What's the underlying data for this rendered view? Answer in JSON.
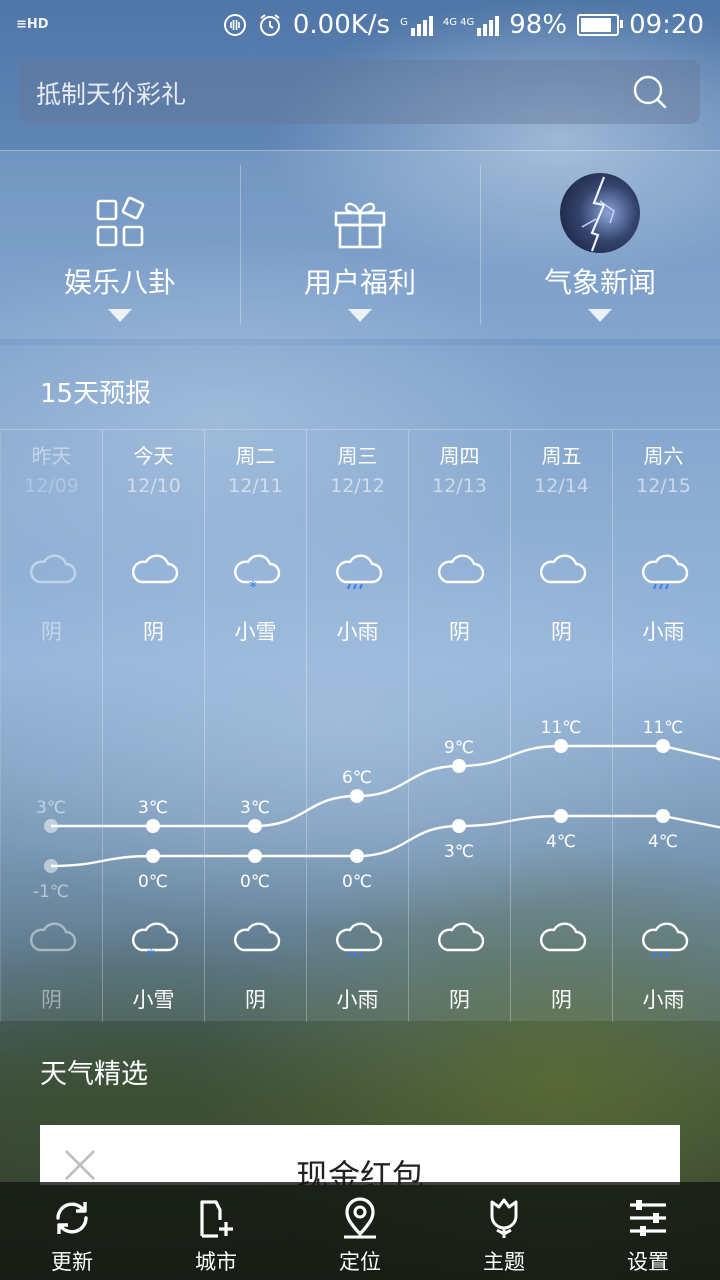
{
  "status_bar": {
    "left_label": "≡HD",
    "net_speed": "0.00K/s",
    "sim1": "G",
    "sim2": "4G 4G",
    "battery": "98%",
    "time": "09:20"
  },
  "search": {
    "placeholder": "抵制天价彩礼"
  },
  "categories": [
    {
      "label": "娱乐八卦",
      "icon": "apps-icon"
    },
    {
      "label": "用户福利",
      "icon": "gift-icon"
    },
    {
      "label": "气象新闻",
      "icon": "lightning-thumbnail"
    }
  ],
  "forecast": {
    "title": "15天预报",
    "days": [
      {
        "day": "昨天",
        "date": "12/09",
        "cond_day": "阴",
        "cond_night": "阴",
        "high": "3℃",
        "low": "-1℃",
        "icon_day": "cloud",
        "icon_night": "cloud"
      },
      {
        "day": "今天",
        "date": "12/10",
        "cond_day": "阴",
        "cond_night": "小雪",
        "high": "3℃",
        "low": "0℃",
        "icon_day": "cloud",
        "icon_night": "snow"
      },
      {
        "day": "周二",
        "date": "12/11",
        "cond_day": "小雪",
        "cond_night": "阴",
        "high": "3℃",
        "low": "0℃",
        "icon_day": "snow",
        "icon_night": "cloud"
      },
      {
        "day": "周三",
        "date": "12/12",
        "cond_day": "小雨",
        "cond_night": "小雨",
        "high": "6℃",
        "low": "0℃",
        "icon_day": "rain",
        "icon_night": "rain"
      },
      {
        "day": "周四",
        "date": "12/13",
        "cond_day": "阴",
        "cond_night": "阴",
        "high": "9℃",
        "low": "3℃",
        "icon_day": "cloud",
        "icon_night": "cloud"
      },
      {
        "day": "周五",
        "date": "12/14",
        "cond_day": "阴",
        "cond_night": "阴",
        "high": "11℃",
        "low": "4℃",
        "icon_day": "cloud",
        "icon_night": "cloud"
      },
      {
        "day": "周六",
        "date": "12/15",
        "cond_day": "小雨",
        "cond_night": "小雨",
        "high": "11℃",
        "low": "4℃",
        "icon_day": "rain",
        "icon_night": "rain"
      }
    ]
  },
  "picks": {
    "title": "天气精选"
  },
  "ad": {
    "title": "现金红包"
  },
  "nav": [
    {
      "label": "更新",
      "icon": "refresh-icon"
    },
    {
      "label": "城市",
      "icon": "city-add-icon"
    },
    {
      "label": "定位",
      "icon": "location-icon"
    },
    {
      "label": "主题",
      "icon": "theme-flower-icon"
    },
    {
      "label": "设置",
      "icon": "settings-sliders-icon"
    }
  ],
  "colors": {
    "snow_dot": "#3d7bf0",
    "rain_dot": "#3d7bf0",
    "chart_line": "#ffffff"
  }
}
